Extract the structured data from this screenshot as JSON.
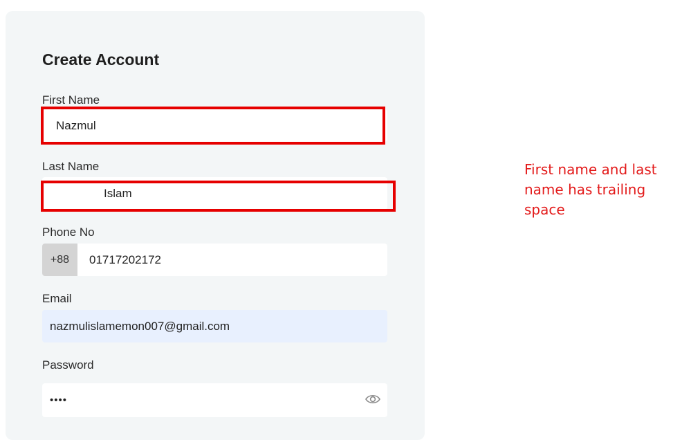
{
  "form": {
    "title": "Create Account",
    "first_name": {
      "label": "First Name",
      "value": "Nazmul"
    },
    "last_name": {
      "label": "Last Name",
      "value": "Islam"
    },
    "phone": {
      "label": "Phone No",
      "prefix": "+88",
      "value": "01717202172"
    },
    "email": {
      "label": "Email",
      "value": "nazmulislamemon007@gmail.com"
    },
    "password": {
      "label": "Password",
      "masked_value": "••••",
      "toggle_icon": "eye-icon"
    }
  },
  "annotation": {
    "text": "First name and last name has trailing space",
    "color": "#e31a1a",
    "highlight_color": "#e60000"
  }
}
